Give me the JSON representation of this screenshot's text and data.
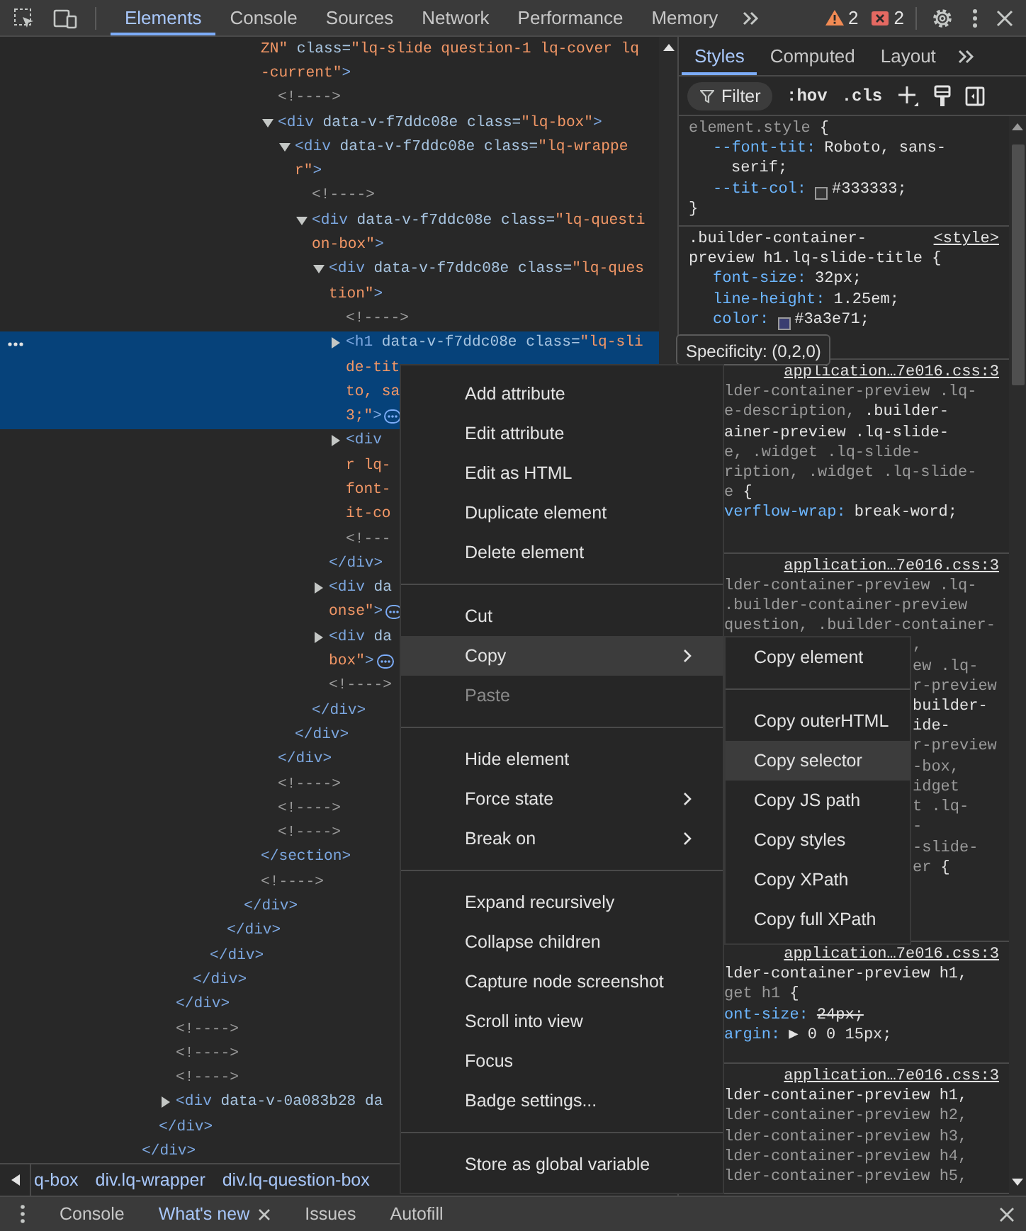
{
  "toolbar": {
    "tabs": [
      {
        "label": "Elements",
        "selected": true
      },
      {
        "label": "Console",
        "selected": false
      },
      {
        "label": "Sources",
        "selected": false
      },
      {
        "label": "Network",
        "selected": false
      },
      {
        "label": "Performance",
        "selected": false
      },
      {
        "label": "Memory",
        "selected": false
      }
    ],
    "warnings": "2",
    "errors": "2"
  },
  "tree": [
    {
      "kind": "element",
      "close": "</div>",
      "children": [
        {
          "kind": "element",
          "close": "</div>",
          "children": [
            {
              "kind": "element",
              "close": "</div>",
              "children": [
                {
                  "kind": "element",
                  "close": "</div>",
                  "children": [
                    {
                      "kind": "element",
                      "close": "</div>",
                      "children": [
                        {
                          "kind": "element",
                          "close": "</div>",
                          "children": [
                            {
                              "kind": "element",
                              "close": "</div>",
                              "children": [
                                {
                                  "kind": "element",
                                  "cut": true,
                                  "selected": false,
                                  "lines": [
                                    "ZN\" class=\"lq-slide question-1 lq-cover lq",
                                    "-current\">"
                                  ],
                                  "close": "</section>",
                                  "children": [
                                    {
                                      "kind": "comment",
                                      "selected": false,
                                      "lines": [
                                        "<!---->"
                                      ]
                                    },
                                    {
                                      "kind": "element",
                                      "expanded": true,
                                      "selected": false,
                                      "lines": [
                                        "<div data-v-f7ddc08e class=\"lq-box\">"
                                      ],
                                      "close": "</div>",
                                      "children": [
                                        {
                                          "kind": "element",
                                          "expanded": true,
                                          "selected": false,
                                          "lines": [
                                            "<div data-v-f7ddc08e class=\"lq-wrappe",
                                            "r\">"
                                          ],
                                          "close": "</div>",
                                          "children": [
                                            {
                                              "kind": "comment",
                                              "selected": false,
                                              "lines": [
                                                "<!---->"
                                              ]
                                            },
                                            {
                                              "kind": "element",
                                              "expanded": true,
                                              "selected": false,
                                              "lines": [
                                                "<div data-v-f7ddc08e class=\"lq-questi",
                                                "on-box\">"
                                              ],
                                              "close": "</div>",
                                              "children": [
                                                {
                                                  "kind": "element",
                                                  "expanded": true,
                                                  "selected": false,
                                                  "lines": [
                                                    "<div data-v-f7ddc08e class=\"lq-ques",
                                                    "tion\">"
                                                  ],
                                                  "close": "</div>",
                                                  "children": [
                                                    {
                                                      "kind": "comment",
                                                      "selected": false,
                                                      "lines": [
                                                        "<!---->"
                                                      ]
                                                    },
                                                    {
                                                      "kind": "element",
                                                      "expanded": false,
                                                      "selected": true,
                                                      "badge": true,
                                                      "lines": [
                                                        "<h1 data-v-f7ddc08e class=\"lq-sli",
                                                        "de-tit",
                                                        "to, sa",
                                                        "3;\">"
                                                      ]
                                                    },
                                                    {
                                                      "kind": "element",
                                                      "expanded": false,
                                                      "selected": false,
                                                      "lines": [
                                                        "<div",
                                                        "r lq-",
                                                        "font-",
                                                        "it-co"
                                                      ]
                                                    },
                                                    {
                                                      "kind": "comment",
                                                      "selected": false,
                                                      "lines": [
                                                        "<!---"
                                                      ]
                                                    }
                                                  ]
                                                },
                                                {
                                                  "kind": "element",
                                                  "expanded": false,
                                                  "selected": false,
                                                  "badge": true,
                                                  "lines": [
                                                    "<div da",
                                                    "onse\">"
                                                  ]
                                                },
                                                {
                                                  "kind": "element",
                                                  "expanded": false,
                                                  "selected": false,
                                                  "badge": true,
                                                  "lines": [
                                                    "<div da",
                                                    "box\">"
                                                  ]
                                                },
                                                {
                                                  "kind": "comment",
                                                  "selected": false,
                                                  "lines": [
                                                    "<!---->"
                                                  ]
                                                }
                                              ]
                                            }
                                          ]
                                        }
                                      ]
                                    },
                                    {
                                      "kind": "comment",
                                      "selected": false,
                                      "lines": [
                                        "<!---->"
                                      ]
                                    },
                                    {
                                      "kind": "comment",
                                      "selected": false,
                                      "lines": [
                                        "<!---->"
                                      ]
                                    },
                                    {
                                      "kind": "comment",
                                      "selected": false,
                                      "lines": [
                                        "<!---->"
                                      ]
                                    }
                                  ]
                                },
                                {
                                  "kind": "comment",
                                  "selected": false,
                                  "lines": [
                                    "<!---->"
                                  ]
                                }
                              ]
                            }
                          ]
                        }
                      ]
                    }
                  ]
                }
              ]
            },
            {
              "kind": "comment",
              "selected": false,
              "lines": [
                "<!---->"
              ]
            },
            {
              "kind": "comment",
              "selected": false,
              "lines": [
                "<!---->"
              ]
            },
            {
              "kind": "comment",
              "selected": false,
              "lines": [
                "<!---->"
              ]
            },
            {
              "kind": "element",
              "expanded": false,
              "selected": false,
              "lines": [
                "<div data-v-0a083b28 da"
              ]
            }
          ]
        }
      ]
    }
  ],
  "breadcrumbs": [
    "q-box",
    "div.lq-wrapper",
    "div.lq-question-box"
  ],
  "styles_pane": {
    "tabs": [
      {
        "label": "Styles",
        "selected": true
      },
      {
        "label": "Computed",
        "selected": false
      },
      {
        "label": "Layout",
        "selected": false
      }
    ],
    "filter": {
      "placeholder": "Filter"
    },
    "toggles": [
      ":hov",
      ".cls"
    ],
    "rules": [
      {
        "lines": [
          {
            "kind": "sel",
            "parts": [
              {
                "text": "element.style",
                "match": false
              },
              {
                "text": " {",
                "match": true
              }
            ]
          },
          {
            "kind": "prop",
            "name": "--font-tit:",
            "value": "Roboto, sans-"
          },
          {
            "kind": "cont",
            "text": "serif;"
          },
          {
            "kind": "prop",
            "name": "--tit-col:",
            "value": "#333333;",
            "color": "#333333"
          },
          {
            "kind": "brace",
            "text": "}"
          }
        ]
      },
      {
        "origin": "<style>",
        "lines": [
          {
            "kind": "sel",
            "parts": [
              {
                "text": ".builder-container-",
                "match": true
              }
            ]
          },
          {
            "kind": "sel",
            "parts": [
              {
                "text": "preview h1.lq-slide-title {",
                "match": true
              }
            ]
          },
          {
            "kind": "prop",
            "name": "font-size:",
            "value": "32px;"
          },
          {
            "kind": "prop",
            "name": "line-height:",
            "value": "1.25em;"
          },
          {
            "kind": "prop",
            "name": "color:",
            "value": "#3a3e71;",
            "color": "#3a3e71"
          }
        ]
      },
      {
        "origin": "application…7e016.css:3",
        "lines": [
          {
            "kind": "sel",
            "parts": [
              {
                "text": "lder-container-preview .lq-",
                "match": false
              }
            ]
          },
          {
            "kind": "sel",
            "parts": [
              {
                "text": "e-description, ",
                "match": false
              },
              {
                "text": ".builder-",
                "match": true
              }
            ]
          },
          {
            "kind": "sel",
            "parts": [
              {
                "text": "ainer-preview .lq-slide-",
                "match": true
              }
            ]
          },
          {
            "kind": "sel",
            "parts": [
              {
                "text": "e, .widget .lq-slide-",
                "match": false
              }
            ]
          },
          {
            "kind": "sel",
            "parts": [
              {
                "text": "ription, .widget .lq-slide-",
                "match": false
              }
            ]
          },
          {
            "kind": "sel",
            "parts": [
              {
                "text": "e",
                "match": false
              },
              {
                "text": " {",
                "match": true
              }
            ]
          },
          {
            "kind": "prop",
            "name": "verflow-wrap:",
            "value": "break-word;"
          }
        ]
      },
      {
        "origin": "application…7e016.css:3",
        "lines": [
          {
            "kind": "sel",
            "parts": [
              {
                "text": "lder-container-preview .lq-",
                "match": false
              }
            ]
          },
          {
            "kind": "sel",
            "parts": [
              {
                "text": ".builder-container-preview",
                "match": false
              }
            ]
          },
          {
            "kind": "sel",
            "parts": [
              {
                "text": "question, .builder-container-",
                "match": false
              }
            ]
          },
          {
            "kind": "tail",
            "parts": [
              {
                "text": ",",
                "match": false
              }
            ]
          },
          {
            "kind": "tail",
            "parts": [
              {
                "text": "ew .lq-",
                "match": false
              }
            ]
          },
          {
            "kind": "tail",
            "parts": [
              {
                "text": "r-preview",
                "match": false
              }
            ]
          },
          {
            "kind": "tail",
            "parts": [
              {
                "text": "builder-",
                "match": true
              }
            ]
          },
          {
            "kind": "tail",
            "parts": [
              {
                "text": "ide-",
                "match": true
              }
            ]
          },
          {
            "kind": "tail",
            "parts": [
              {
                "text": "r-preview",
                "match": false
              }
            ]
          },
          {
            "kind": "tail",
            "parts": [
              {
                "text": "-box,",
                "match": false
              }
            ]
          },
          {
            "kind": "tail",
            "parts": [
              {
                "text": "idget",
                "match": false
              }
            ]
          },
          {
            "kind": "tail",
            "parts": [
              {
                "text": "t .lq-",
                "match": false
              }
            ]
          },
          {
            "kind": "tail",
            "parts": [
              {
                "text": "-",
                "match": false
              }
            ]
          },
          {
            "kind": "tail",
            "parts": [
              {
                "text": "-slide-",
                "match": false
              }
            ]
          },
          {
            "kind": "tail",
            "parts": [
              {
                "text": "er",
                "match": false
              },
              {
                "text": " {",
                "match": true
              }
            ]
          }
        ]
      },
      {
        "origin": "application…7e016.css:3",
        "lines": [
          {
            "kind": "sel",
            "parts": [
              {
                "text": "lder-container-preview h1,",
                "match": true
              }
            ]
          },
          {
            "kind": "sel",
            "parts": [
              {
                "text": "get h1",
                "match": false
              },
              {
                "text": " {",
                "match": true
              }
            ]
          },
          {
            "kind": "prop",
            "name": "ont-size:",
            "value": "24px;",
            "struck": true
          },
          {
            "kind": "prop",
            "name": "argin:",
            "value": "▶ 0 0 15px;"
          }
        ]
      },
      {
        "origin": "application…7e016.css:3",
        "lines": [
          {
            "kind": "sel",
            "parts": [
              {
                "text": "lder-container-preview h1,",
                "match": true
              }
            ]
          },
          {
            "kind": "sel",
            "parts": [
              {
                "text": "lder-container-preview h2,",
                "match": false
              }
            ]
          },
          {
            "kind": "sel",
            "parts": [
              {
                "text": "lder-container-preview h3,",
                "match": false
              }
            ]
          },
          {
            "kind": "sel",
            "parts": [
              {
                "text": "lder-container-preview h4,",
                "match": false
              }
            ]
          },
          {
            "kind": "sel",
            "parts": [
              {
                "text": "lder-container-preview h5,",
                "match": false
              }
            ]
          }
        ]
      }
    ]
  },
  "tooltip": "Specificity: (0,2,0)",
  "context_menu": {
    "groups": [
      [
        {
          "label": "Add attribute",
          "selected": false,
          "disabled": false,
          "submenu": false
        },
        {
          "label": "Edit attribute",
          "selected": false,
          "disabled": false,
          "submenu": false
        },
        {
          "label": "Edit as HTML",
          "selected": false,
          "disabled": false,
          "submenu": false
        },
        {
          "label": "Duplicate element",
          "selected": false,
          "disabled": false,
          "submenu": false
        },
        {
          "label": "Delete element",
          "selected": false,
          "disabled": false,
          "submenu": false
        }
      ],
      [
        {
          "label": "Cut",
          "selected": false,
          "disabled": false,
          "submenu": false
        },
        {
          "label": "Copy",
          "selected": true,
          "disabled": false,
          "submenu": true
        },
        {
          "label": "Paste",
          "selected": false,
          "disabled": true,
          "submenu": false
        }
      ],
      [
        {
          "label": "Hide element",
          "selected": false,
          "disabled": false,
          "submenu": false
        },
        {
          "label": "Force state",
          "selected": false,
          "disabled": false,
          "submenu": true
        },
        {
          "label": "Break on",
          "selected": false,
          "disabled": false,
          "submenu": true
        }
      ],
      [
        {
          "label": "Expand recursively",
          "selected": false,
          "disabled": false,
          "submenu": false
        },
        {
          "label": "Collapse children",
          "selected": false,
          "disabled": false,
          "submenu": false
        },
        {
          "label": "Capture node screenshot",
          "selected": false,
          "disabled": false,
          "submenu": false
        },
        {
          "label": "Scroll into view",
          "selected": false,
          "disabled": false,
          "submenu": false
        },
        {
          "label": "Focus",
          "selected": false,
          "disabled": false,
          "submenu": false
        },
        {
          "label": "Badge settings...",
          "selected": false,
          "disabled": false,
          "submenu": false
        }
      ],
      [
        {
          "label": "Store as global variable",
          "selected": false,
          "disabled": false,
          "submenu": false
        }
      ]
    ]
  },
  "copy_submenu": {
    "groups": [
      [
        {
          "label": "Copy element",
          "selected": false
        }
      ],
      [
        {
          "label": "Copy outerHTML",
          "selected": false
        },
        {
          "label": "Copy selector",
          "selected": true
        },
        {
          "label": "Copy JS path",
          "selected": false
        },
        {
          "label": "Copy styles",
          "selected": false
        },
        {
          "label": "Copy XPath",
          "selected": false
        },
        {
          "label": "Copy full XPath",
          "selected": false
        }
      ]
    ]
  },
  "drawer": {
    "tabs": [
      {
        "label": "Console",
        "selected": false,
        "closable": false
      },
      {
        "label": "What's new",
        "selected": true,
        "closable": true
      },
      {
        "label": "Issues",
        "selected": false,
        "closable": false
      },
      {
        "label": "Autofill",
        "selected": false,
        "closable": false
      }
    ]
  }
}
